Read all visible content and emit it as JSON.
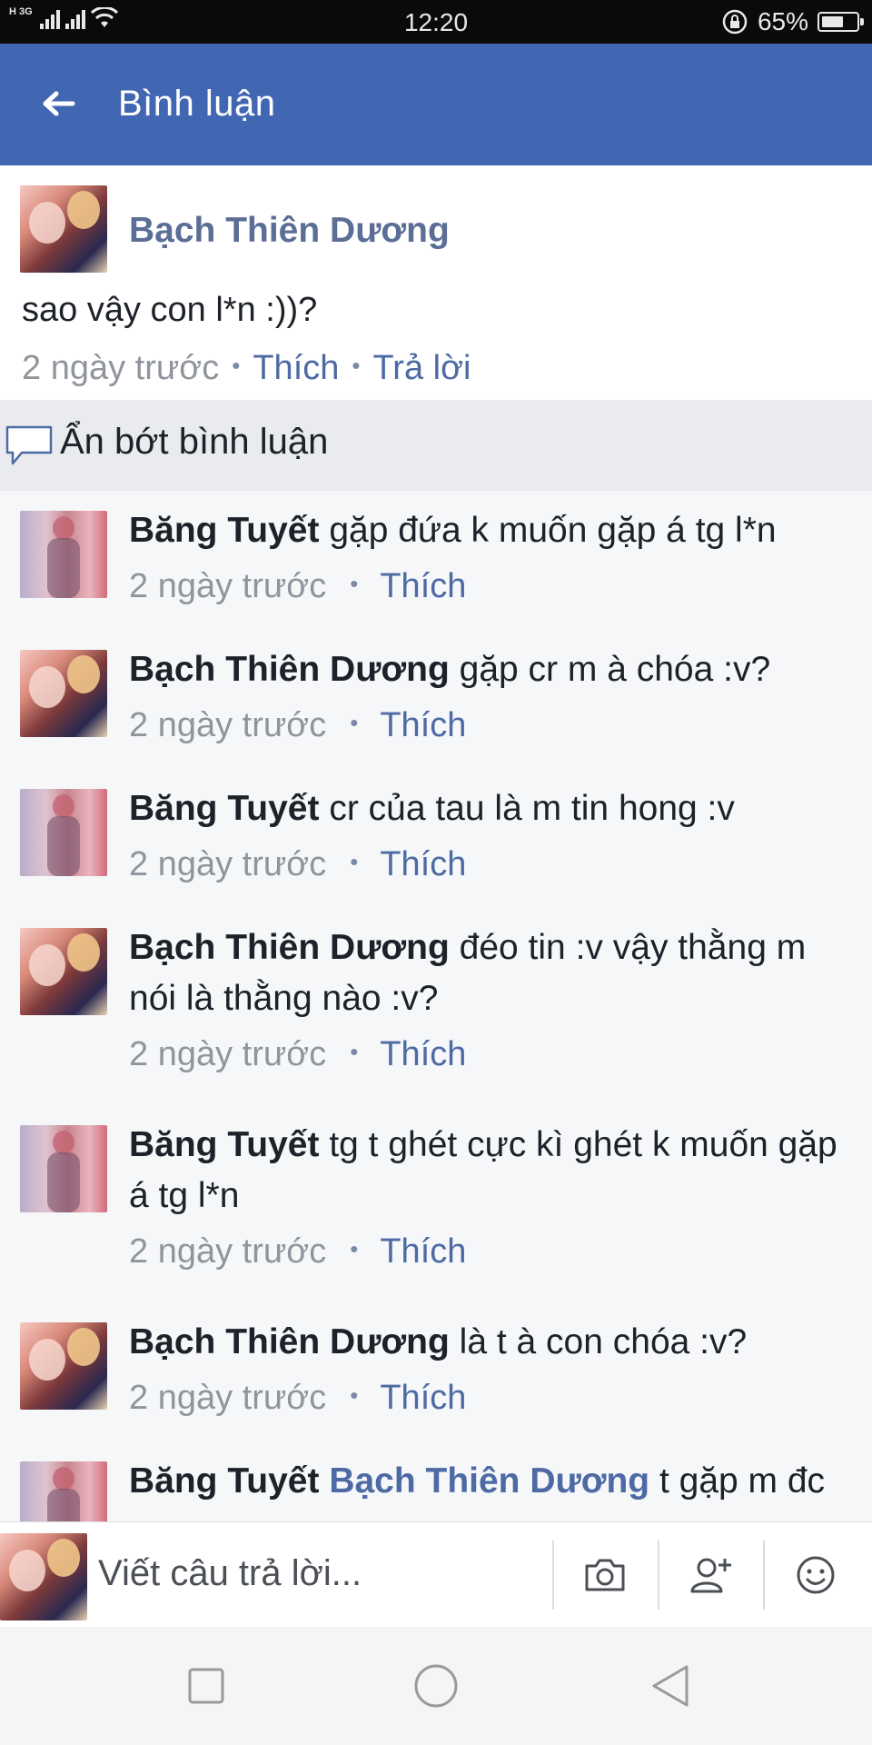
{
  "status_bar": {
    "network": "H 3G",
    "time": "12:20",
    "battery": "65%",
    "battery_level": 0.65
  },
  "header": {
    "title": "Bình luận"
  },
  "parent_comment": {
    "author": "Bạch Thiên Dương",
    "text": "sao vậy con l*n :))?",
    "time": "2 ngày trước",
    "like": "Thích",
    "reply": "Trả lời"
  },
  "hide_replies": {
    "label": "Ẩn bớt bình luận"
  },
  "replies": [
    {
      "author": "Băng Tuyết",
      "text": "gặp đứa k muốn gặp á tg l*n",
      "time": "2 ngày trước",
      "like": "Thích",
      "avatar": "blur"
    },
    {
      "author": "Bạch Thiên Dương",
      "text": "gặp cr m à chóa :v?",
      "time": "2 ngày trước",
      "like": "Thích",
      "avatar": "anime"
    },
    {
      "author": "Băng Tuyết",
      "text": "cr của tau là m tin hong :v",
      "time": "2 ngày trước",
      "like": "Thích",
      "avatar": "blur"
    },
    {
      "author": "Bạch Thiên Dương",
      "text": "đéo tin :v vậy thằng m nói là thằng nào :v?",
      "time": "2 ngày trước",
      "like": "Thích",
      "avatar": "anime"
    },
    {
      "author": "Băng Tuyết",
      "text": "tg t ghét cực kì ghét k muốn gặp á tg l*n",
      "time": "2 ngày trước",
      "like": "Thích",
      "avatar": "blur"
    },
    {
      "author": "Bạch Thiên Dương",
      "text": "là t à con chóa :v?",
      "time": "2 ngày trước",
      "like": "Thích",
      "avatar": "anime"
    },
    {
      "author": "Băng Tuyết",
      "mention": "Bạch Thiên Dương",
      "text": "t gặp m đc",
      "time": "",
      "like": "",
      "avatar": "blur"
    }
  ],
  "composer": {
    "placeholder": "Viết câu trả lời..."
  },
  "icons": {
    "back": "back-arrow-icon",
    "hide": "speech-bubble-icon",
    "camera": "camera-icon",
    "add_person": "add-person-icon",
    "emoji": "smiley-icon",
    "nav_recents": "square-icon",
    "nav_home": "circle-icon",
    "nav_back": "triangle-back-icon"
  },
  "colors": {
    "header": "#4267b2",
    "link": "#4d6aa4",
    "author": "#5b6e96",
    "meta": "#90949c",
    "reply_bg": "#f6f7f9"
  }
}
